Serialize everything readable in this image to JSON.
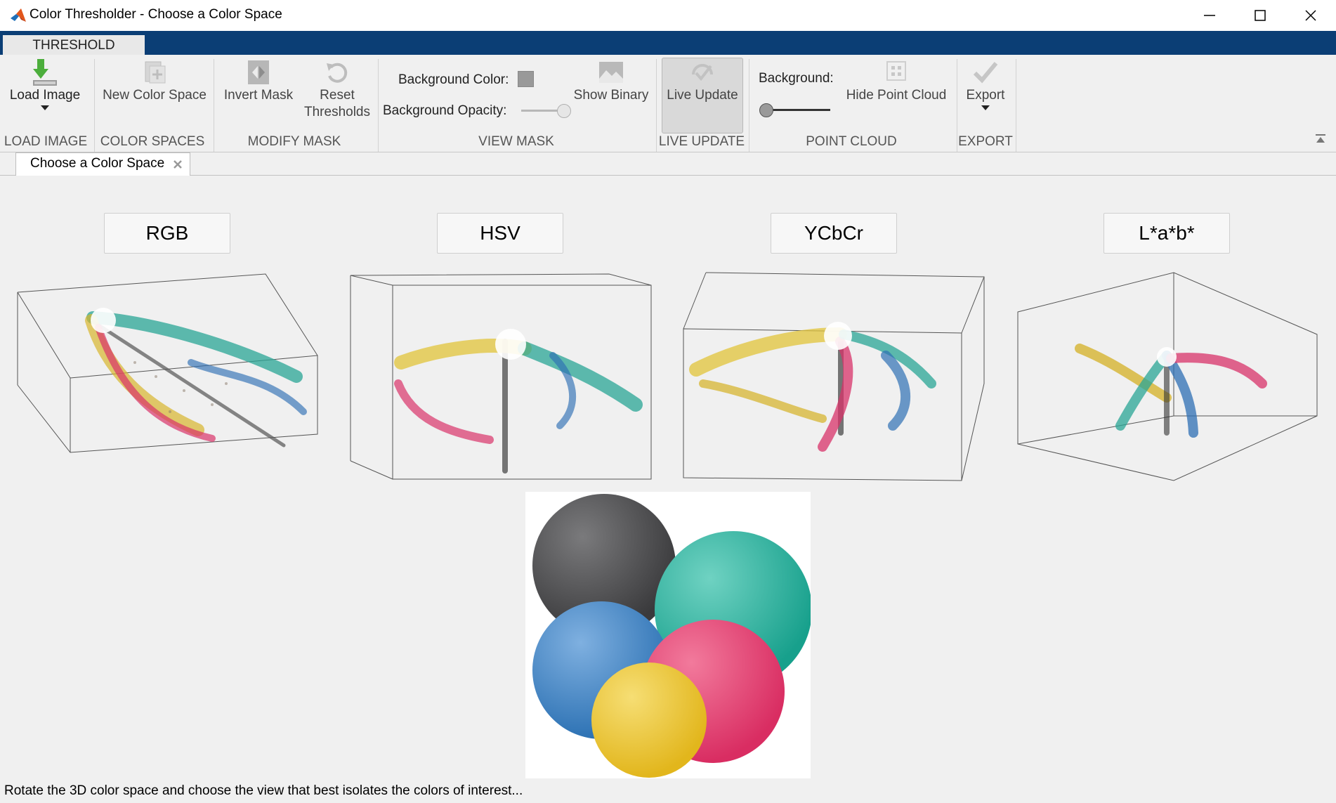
{
  "window": {
    "title": "Color Thresholder - Choose a Color Space"
  },
  "ribbon": {
    "tab": "THRESHOLD",
    "groups": {
      "load_image": "LOAD IMAGE",
      "color_spaces": "COLOR SPACES",
      "modify_mask": "MODIFY MASK",
      "view_mask": "VIEW MASK",
      "live_update": "LIVE UPDATE",
      "point_cloud": "POINT CLOUD",
      "export": "EXPORT"
    },
    "buttons": {
      "load_image": "Load Image",
      "new_color_space": "New Color Space",
      "invert_mask": "Invert Mask",
      "reset_line1": "Reset",
      "reset_line2": "Thresholds",
      "show_binary": "Show Binary",
      "live_update": "Live Update",
      "hide_point_cloud": "Hide Point Cloud",
      "export": "Export"
    },
    "view_mask": {
      "background_color_label": "Background Color:",
      "background_color": "#999999",
      "background_opacity_label": "Background Opacity:",
      "background_opacity": 1.0
    },
    "point_cloud": {
      "background_label": "Background:",
      "background_level": 0.0
    }
  },
  "document_tab": {
    "label": "Choose a Color Space"
  },
  "color_spaces": [
    {
      "label": "RGB"
    },
    {
      "label": "HSV"
    },
    {
      "label": "YCbCr"
    },
    {
      "label": "L*a*b*"
    }
  ],
  "colors": {
    "tabstrip": "#0b3e75",
    "ball_black": "#3a3a3c",
    "ball_teal": "#17a08c",
    "ball_blue": "#2d72b4",
    "ball_pink": "#d92d62",
    "ball_yellow": "#e2b61c"
  },
  "status": {
    "text": "Rotate the 3D color space and choose the view that best isolates the colors of interest..."
  }
}
